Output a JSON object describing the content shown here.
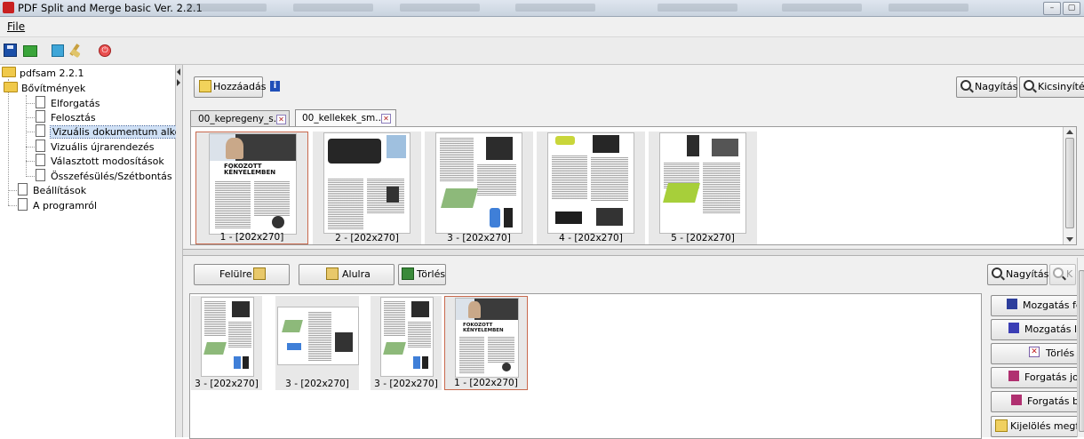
{
  "window": {
    "title": "PDF Split and Merge basic Ver. 2.2.1"
  },
  "menu": {
    "file": "File"
  },
  "toolbar_icons": [
    "save-icon",
    "open-icon",
    "environment-icon",
    "clear-icon",
    "exit-icon"
  ],
  "tree": {
    "root": "pdfsam 2.2.1",
    "plugins": "Bővítmények",
    "items": [
      "Elforgatás",
      "Felosztás",
      "Vizuális dokumentum alkotó",
      "Vizuális újrarendezés",
      "Választott modosítások",
      "Összefésülés/Szétbontás"
    ],
    "settings": "Beállítások",
    "about": "A programról",
    "selected_index": 2
  },
  "top": {
    "add_label": "Hozzáadás",
    "info_label": "i",
    "zoom_in": "Nagyítás",
    "zoom_out": "Kicsinyítés",
    "tabs": [
      "00_kepregeny_s..",
      "00_kellekek_sm.."
    ],
    "active_tab": 1,
    "thumbs": [
      {
        "label": "1 - [202x270]",
        "selected": true
      },
      {
        "label": "2 - [202x270]",
        "selected": false
      },
      {
        "label": "3 - [202x270]",
        "selected": false
      },
      {
        "label": "4 - [202x270]",
        "selected": false
      },
      {
        "label": "5 - [202x270]",
        "selected": false
      }
    ],
    "page_heading": [
      "FOKOZOTT",
      "KÉNYELEMBEN"
    ]
  },
  "bottom": {
    "up_label": "Felülre",
    "down_label": "Alulra",
    "delete_label": "Törlés",
    "zoom_in": "Nagyítás",
    "zoom_out": "K",
    "thumbs": [
      {
        "label": "3 - [202x270]",
        "selected": false
      },
      {
        "label": "3 - [202x270]",
        "selected": false
      },
      {
        "label": "3 - [202x270]",
        "selected": false
      },
      {
        "label": "1 - [202x270]",
        "selected": true
      }
    ],
    "side_buttons": [
      "Mozgatás fel",
      "Mozgatás le",
      "Törlés",
      "Forgatás job",
      "Forgatás ba",
      "Kijelölés megfo"
    ]
  },
  "colors": {
    "accent": "#1f4fb8",
    "selection_border": "#c8694d",
    "tree_selection": "#cfe0f5"
  }
}
